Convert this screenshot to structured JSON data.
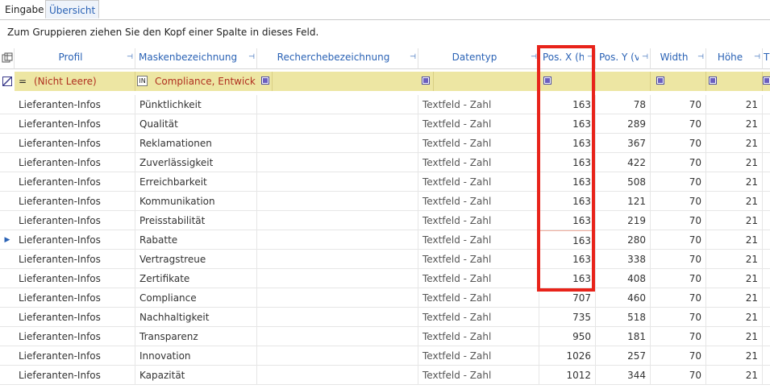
{
  "tabs": [
    "Eingabe",
    "Übersicht"
  ],
  "group_panel_text": "Zum Gruppieren ziehen Sie den Kopf einer Spalte in dieses Feld.",
  "columns": [
    {
      "key": "profil",
      "label": "Profil"
    },
    {
      "key": "maske",
      "label": "Maskenbezeichnung"
    },
    {
      "key": "rech",
      "label": "Recherchebezeichnung"
    },
    {
      "key": "typ",
      "label": "Datentyp"
    },
    {
      "key": "posx",
      "label": "Pos. X (h"
    },
    {
      "key": "posy",
      "label": "Pos. Y (v"
    },
    {
      "key": "width",
      "label": "Width"
    },
    {
      "key": "hoehe",
      "label": "Höhe"
    },
    {
      "key": "extra",
      "label": "T"
    }
  ],
  "filter_row": {
    "operator": "=",
    "profil": "(Nicht Leere)",
    "maske_operator": "IN",
    "maske": "Compliance, Entwickl"
  },
  "rows": [
    {
      "profil": "Lieferanten-Infos",
      "maske": "Pünktlichkeit",
      "rech": "",
      "typ": "Textfeld - Zahl",
      "posx": "163",
      "posy": "78",
      "width": "70",
      "hoehe": "21"
    },
    {
      "profil": "Lieferanten-Infos",
      "maske": "Qualität",
      "rech": "",
      "typ": "Textfeld - Zahl",
      "posx": "163",
      "posy": "289",
      "width": "70",
      "hoehe": "21"
    },
    {
      "profil": "Lieferanten-Infos",
      "maske": "Reklamationen",
      "rech": "",
      "typ": "Textfeld - Zahl",
      "posx": "163",
      "posy": "367",
      "width": "70",
      "hoehe": "21"
    },
    {
      "profil": "Lieferanten-Infos",
      "maske": "Zuverlässigkeit",
      "rech": "",
      "typ": "Textfeld - Zahl",
      "posx": "163",
      "posy": "422",
      "width": "70",
      "hoehe": "21"
    },
    {
      "profil": "Lieferanten-Infos",
      "maske": "Erreichbarkeit",
      "rech": "",
      "typ": "Textfeld - Zahl",
      "posx": "163",
      "posy": "508",
      "width": "70",
      "hoehe": "21"
    },
    {
      "profil": "Lieferanten-Infos",
      "maske": "Kommunikation",
      "rech": "",
      "typ": "Textfeld - Zahl",
      "posx": "163",
      "posy": "121",
      "width": "70",
      "hoehe": "21"
    },
    {
      "profil": "Lieferanten-Infos",
      "maske": "Preisstabilität",
      "rech": "",
      "typ": "Textfeld - Zahl",
      "posx": "163",
      "posy": "219",
      "width": "70",
      "hoehe": "21"
    },
    {
      "profil": "Lieferanten-Infos",
      "maske": "Rabatte",
      "rech": "",
      "typ": "Textfeld - Zahl",
      "posx": "163",
      "posy": "280",
      "width": "70",
      "hoehe": "21",
      "current": true
    },
    {
      "profil": "Lieferanten-Infos",
      "maske": "Vertragstreue",
      "rech": "",
      "typ": "Textfeld - Zahl",
      "posx": "163",
      "posy": "338",
      "width": "70",
      "hoehe": "21"
    },
    {
      "profil": "Lieferanten-Infos",
      "maske": "Zertifikate",
      "rech": "",
      "typ": "Textfeld - Zahl",
      "posx": "163",
      "posy": "408",
      "width": "70",
      "hoehe": "21"
    },
    {
      "profil": "Lieferanten-Infos",
      "maske": "Compliance",
      "rech": "",
      "typ": "Textfeld - Zahl",
      "posx": "707",
      "posy": "460",
      "width": "70",
      "hoehe": "21"
    },
    {
      "profil": "Lieferanten-Infos",
      "maske": "Nachhaltigkeit",
      "rech": "",
      "typ": "Textfeld - Zahl",
      "posx": "735",
      "posy": "518",
      "width": "70",
      "hoehe": "21"
    },
    {
      "profil": "Lieferanten-Infos",
      "maske": "Transparenz",
      "rech": "",
      "typ": "Textfeld - Zahl",
      "posx": "950",
      "posy": "181",
      "width": "70",
      "hoehe": "21"
    },
    {
      "profil": "Lieferanten-Infos",
      "maske": "Innovation",
      "rech": "",
      "typ": "Textfeld - Zahl",
      "posx": "1026",
      "posy": "257",
      "width": "70",
      "hoehe": "21"
    },
    {
      "profil": "Lieferanten-Infos",
      "maske": "Kapazität",
      "rech": "",
      "typ": "Textfeld - Zahl",
      "posx": "1012",
      "posy": "344",
      "width": "70",
      "hoehe": "21"
    }
  ],
  "colors": {
    "accent": "#2a62b5",
    "filter_bg": "#ede6a3",
    "filter_text": "#b03020",
    "highlight": "#e8231a"
  },
  "icons": {
    "header_corner": "column-chooser-icon",
    "filter_corner": "clear-filter-icon",
    "pin": "pin-icon",
    "current_row": "row-indicator-icon"
  }
}
